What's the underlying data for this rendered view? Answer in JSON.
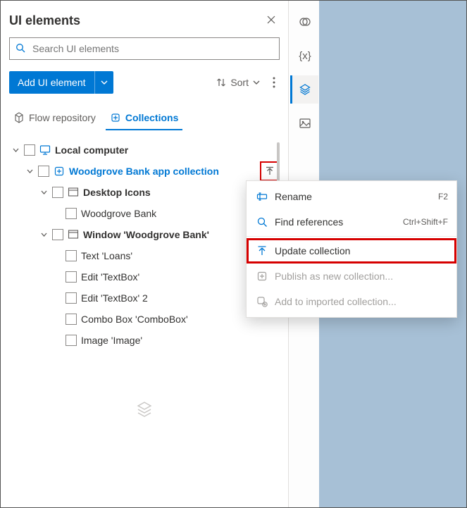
{
  "panel": {
    "title": "UI elements",
    "search_placeholder": "Search UI elements",
    "add_button": "Add UI element",
    "sort_label": "Sort"
  },
  "tabs": {
    "repo": "Flow repository",
    "collections": "Collections"
  },
  "tree": {
    "root": "Local computer",
    "collection": "Woodgrove Bank app collection",
    "group_desktop": "Desktop Icons",
    "item_desktop_0": "Woodgrove Bank",
    "group_window": "Window 'Woodgrove Bank'",
    "item_win_0": "Text 'Loans'",
    "item_win_1": "Edit 'TextBox'",
    "item_win_2": "Edit 'TextBox' 2",
    "item_win_3": "Combo Box 'ComboBox'",
    "item_win_4": "Image 'Image'"
  },
  "context_menu": {
    "rename": "Rename",
    "rename_key": "F2",
    "find": "Find references",
    "find_key": "Ctrl+Shift+F",
    "update": "Update collection",
    "publish": "Publish as new collection...",
    "add_imported": "Add to imported collection..."
  }
}
